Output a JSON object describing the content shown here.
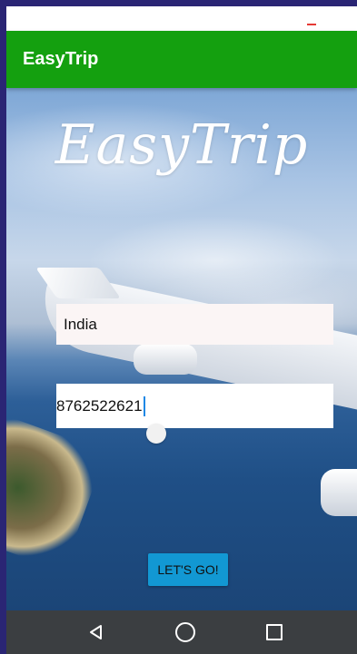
{
  "app_bar": {
    "title": "EasyTrip"
  },
  "hero": {
    "logo_text": "EasyTrip"
  },
  "form": {
    "country_value": "India",
    "phone_value": "8762522621",
    "submit_label": "LET'S GO!"
  },
  "colors": {
    "app_bar": "#14a00f",
    "button": "#1298d3",
    "nav_bar": "#3b3e41",
    "frame_border": "#2a2574"
  },
  "navigation": {
    "icons": [
      "back-icon",
      "home-icon",
      "recent-apps-icon"
    ]
  }
}
